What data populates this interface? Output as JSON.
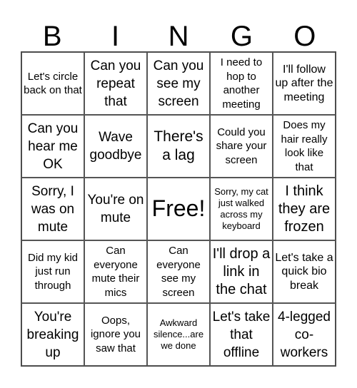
{
  "title_letters": [
    "B",
    "I",
    "N",
    "G",
    "O"
  ],
  "cells": [
    "Let's circle back on that",
    "Can you repeat that",
    "Can you see my screen",
    "I need to hop to another meeting",
    "I'll follow up after the meeting",
    "Can you hear me OK",
    "Wave goodbye",
    "There's a lag",
    "Could you share your screen",
    "Does my hair really look like that",
    "Sorry, I was on mute",
    "You're on mute",
    "Free!",
    "Sorry, my cat just walked across my keyboard",
    "I think they are frozen",
    "Did my kid just run through",
    "Can everyone mute their mics",
    "Can everyone see my screen",
    "I'll drop a link in the chat",
    "Let's take a quick bio break",
    "You're breaking up",
    "Oops, ignore you saw that",
    "Awkward silence...are we done",
    "Let's take that offline",
    "4-legged co-workers"
  ]
}
